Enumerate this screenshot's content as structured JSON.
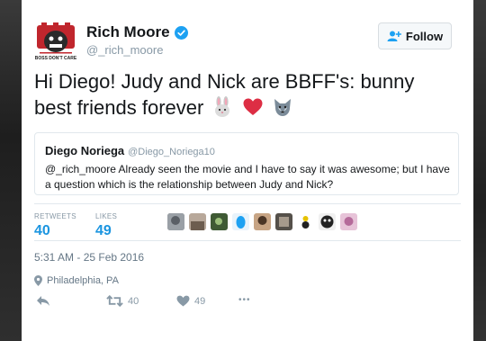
{
  "author": {
    "name": "Rich Moore",
    "handle": "@_rich_moore",
    "avatar_caption": "BOSS DON'T CARE"
  },
  "follow_button": {
    "label": "Follow"
  },
  "tweet": {
    "text": "Hi Diego! Judy and Nick are BBFF's: bunny best friends forever",
    "emojis": [
      "rabbit-face",
      "red-heart",
      "wolf-face"
    ]
  },
  "quoted": {
    "name": "Diego Noriega",
    "handle": "@Diego_Noriega10",
    "text": "@_rich_moore Already seen the movie and I have to say it was awesome; but I have a question which is the relationship between Judy and Nick?"
  },
  "stats": {
    "retweets_label": "RETWEETS",
    "retweets": "40",
    "likes_label": "LIKES",
    "likes": "49"
  },
  "liker_count": 9,
  "timestamp": "5:31 AM - 25 Feb 2016",
  "location": "Philadelphia, PA",
  "actions": {
    "retweet_count": "40",
    "like_count": "49",
    "more": "•••"
  },
  "colors": {
    "accent": "#1b95e0",
    "heart": "#e0245e",
    "muted": "#8899a6"
  }
}
